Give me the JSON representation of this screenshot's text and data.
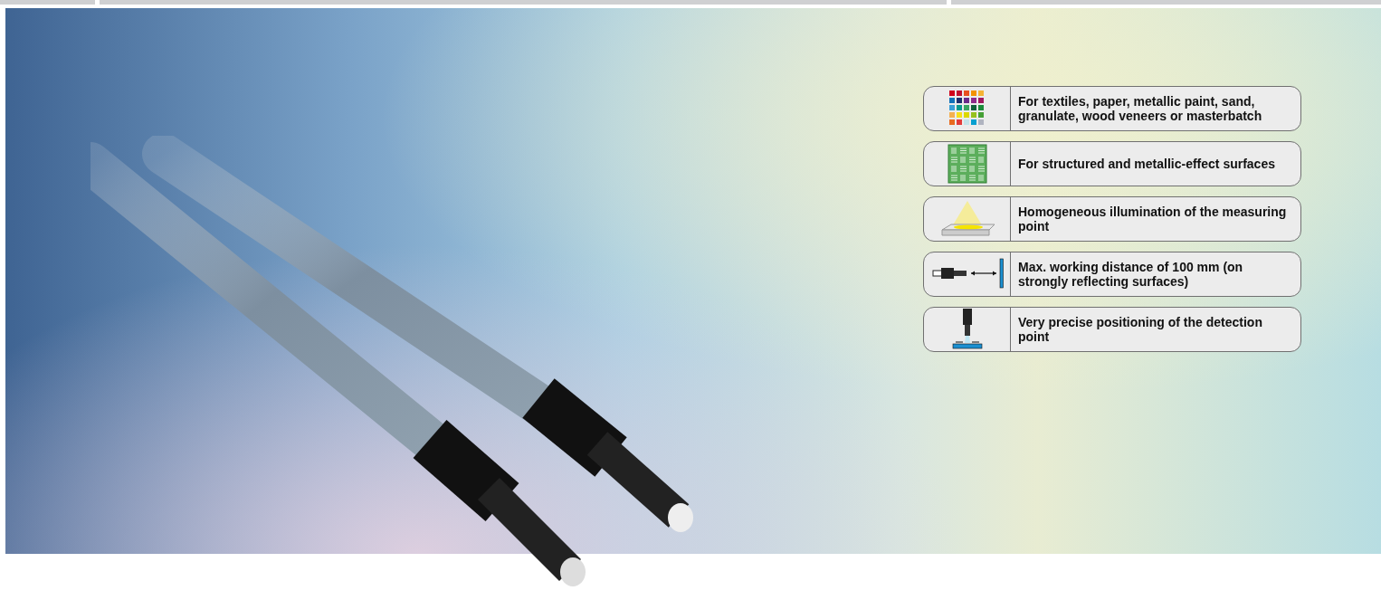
{
  "features": [
    {
      "kind": "color-grid",
      "text": "For textiles, paper, metallic paint, sand, granulate, wood veneers or masterbatch"
    },
    {
      "kind": "texture",
      "text": "For structured and metallic-effect surfaces"
    },
    {
      "kind": "illumination",
      "text": "Homogeneous illumination of the measuring point"
    },
    {
      "kind": "distance",
      "text": "Max. working distance of 100 mm (on strongly reflecting surfaces)"
    },
    {
      "kind": "positioning",
      "text": "Very precise positioning of the detection point"
    }
  ]
}
